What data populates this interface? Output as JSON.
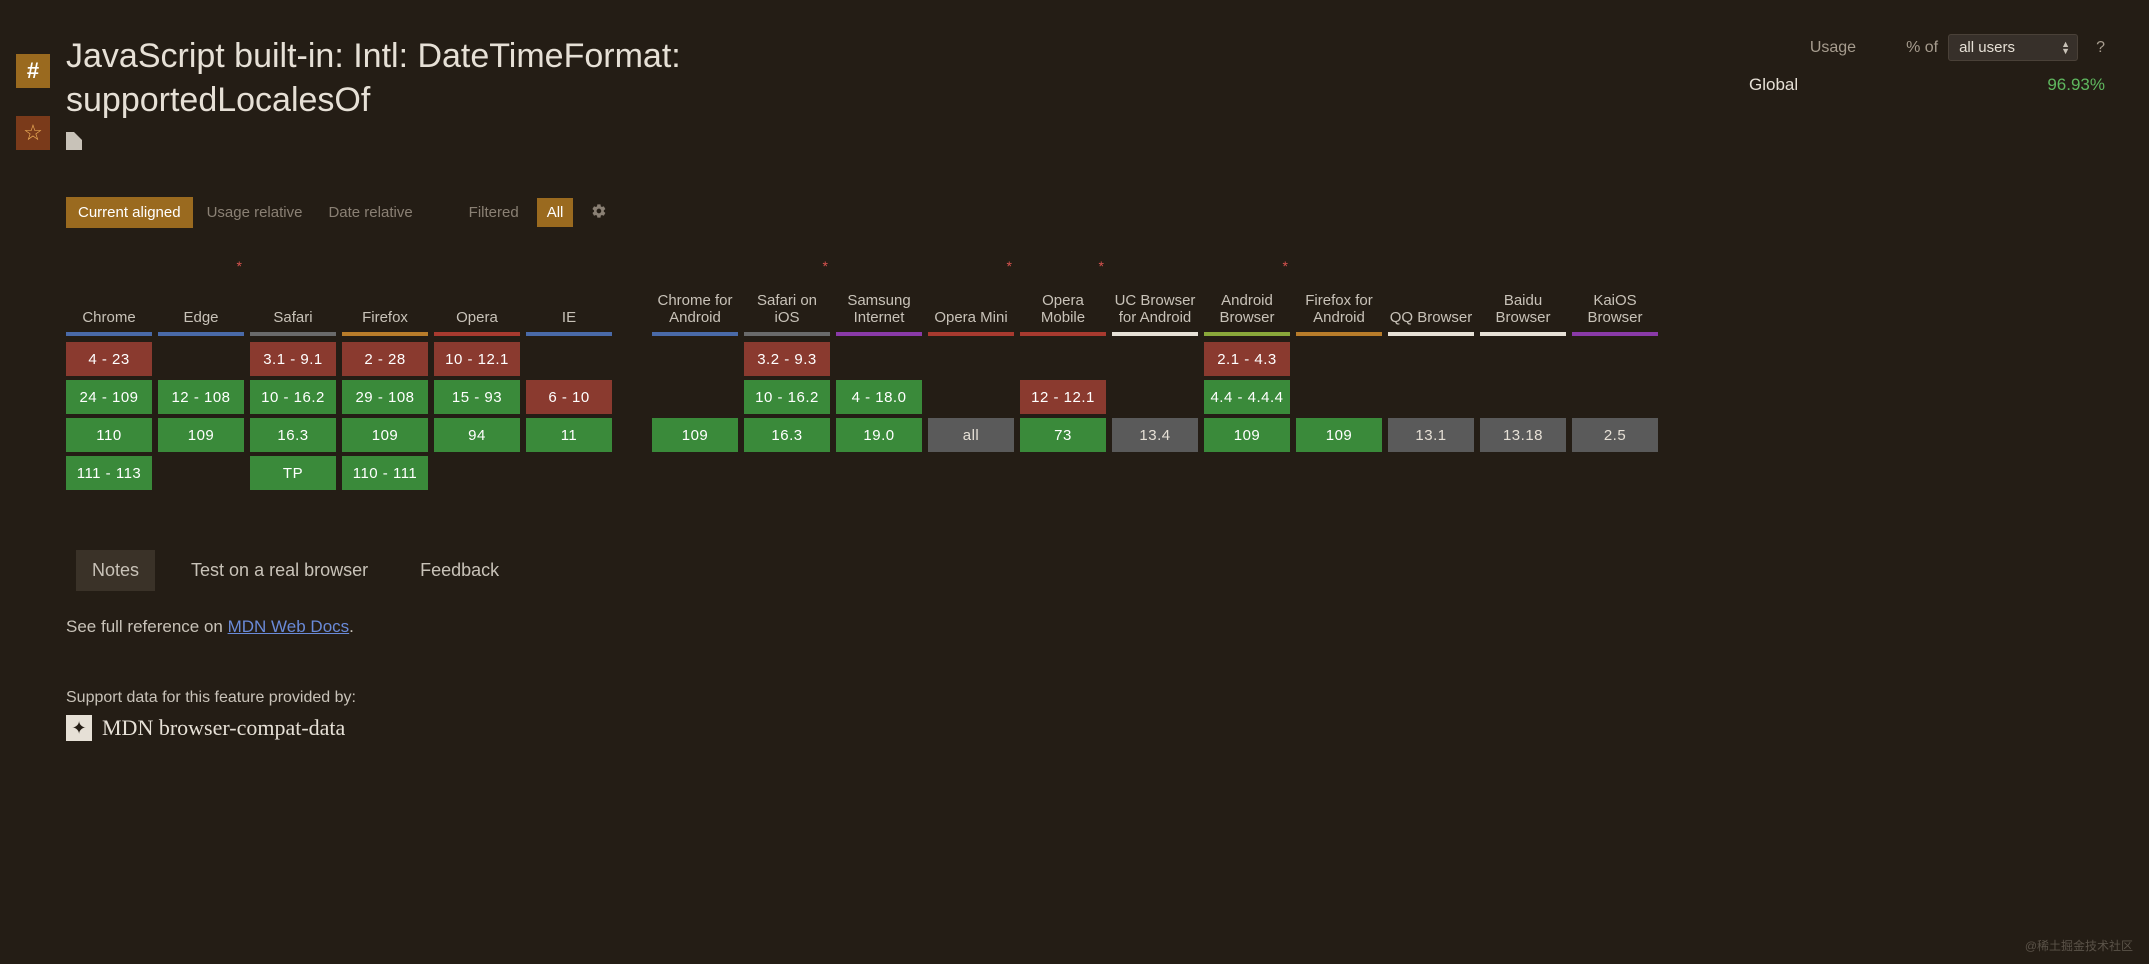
{
  "title": "JavaScript built-in: Intl: DateTimeFormat: supportedLocalesOf",
  "usage": {
    "label": "Usage",
    "pct_prefix": "% of",
    "select_value": "all users",
    "help": "?",
    "global_label": "Global",
    "global_pct": "96.93%"
  },
  "view_tabs": {
    "current": "Current aligned",
    "usage_rel": "Usage relative",
    "date_rel": "Date relative"
  },
  "filter": {
    "label": "Filtered",
    "all": "All"
  },
  "lower_tabs": {
    "notes": "Notes",
    "test": "Test on a real browser",
    "feedback": "Feedback"
  },
  "notes": {
    "see_ref_prefix": "See full reference on ",
    "see_ref_link": "MDN Web Docs",
    "see_ref_suffix": "."
  },
  "provided": {
    "line": "Support data for this feature provided by:",
    "source": "MDN browser-compat-data"
  },
  "watermark": "@稀土掘金技术社区",
  "groups": [
    {
      "browsers": [
        {
          "name": "Chrome",
          "underline": "#4a6aa8",
          "star": false,
          "rows": [
            {
              "t": "4 - 23",
              "c": "red"
            },
            {
              "t": "24 - 109",
              "c": "green"
            },
            {
              "t": "110",
              "c": "green"
            },
            {
              "t": "111 - 113",
              "c": "green"
            }
          ]
        },
        {
          "name": "Edge",
          "underline": "#4a6aa8",
          "star": true,
          "rows": [
            {
              "t": "",
              "c": "empty"
            },
            {
              "t": "12 - 108",
              "c": "green"
            },
            {
              "t": "109",
              "c": "green"
            },
            {
              "t": "",
              "c": "empty"
            }
          ]
        },
        {
          "name": "Safari",
          "underline": "#6a6a6a",
          "star": false,
          "rows": [
            {
              "t": "3.1 - 9.1",
              "c": "red"
            },
            {
              "t": "10 - 16.2",
              "c": "green"
            },
            {
              "t": "16.3",
              "c": "green"
            },
            {
              "t": "TP",
              "c": "green"
            }
          ]
        },
        {
          "name": "Firefox",
          "underline": "#b87c2a",
          "star": false,
          "rows": [
            {
              "t": "2 - 28",
              "c": "red"
            },
            {
              "t": "29 - 108",
              "c": "green"
            },
            {
              "t": "109",
              "c": "green"
            },
            {
              "t": "110 - 111",
              "c": "green"
            }
          ]
        },
        {
          "name": "Opera",
          "underline": "#a83a2f",
          "star": false,
          "rows": [
            {
              "t": "10 - 12.1",
              "c": "red"
            },
            {
              "t": "15 - 93",
              "c": "green"
            },
            {
              "t": "94",
              "c": "green"
            },
            {
              "t": "",
              "c": "empty"
            }
          ]
        },
        {
          "name": "IE",
          "underline": "#4a6aa8",
          "star": false,
          "rows": [
            {
              "t": "",
              "c": "empty"
            },
            {
              "t": "6 - 10",
              "c": "red"
            },
            {
              "t": "11",
              "c": "green"
            },
            {
              "t": "",
              "c": "empty"
            }
          ]
        }
      ]
    },
    {
      "browsers": [
        {
          "name": "Chrome for Android",
          "underline": "#4a6aa8",
          "star": false,
          "rows": [
            {
              "t": "",
              "c": "empty"
            },
            {
              "t": "",
              "c": "empty"
            },
            {
              "t": "109",
              "c": "green"
            }
          ]
        },
        {
          "name": "Safari on iOS",
          "underline": "#6a6a6a",
          "star": true,
          "rows": [
            {
              "t": "3.2 - 9.3",
              "c": "red"
            },
            {
              "t": "10 - 16.2",
              "c": "green"
            },
            {
              "t": "16.3",
              "c": "green"
            }
          ]
        },
        {
          "name": "Samsung Internet",
          "underline": "#8a3aa8",
          "star": false,
          "rows": [
            {
              "t": "",
              "c": "empty"
            },
            {
              "t": "4 - 18.0",
              "c": "green"
            },
            {
              "t": "19.0",
              "c": "green"
            }
          ]
        },
        {
          "name": "Opera Mini",
          "underline": "#a83a2f",
          "star": true,
          "rows": [
            {
              "t": "",
              "c": "empty"
            },
            {
              "t": "",
              "c": "empty"
            },
            {
              "t": "all",
              "c": "gray"
            }
          ]
        },
        {
          "name": "Opera Mobile",
          "underline": "#a83a2f",
          "star": true,
          "rows": [
            {
              "t": "",
              "c": "empty"
            },
            {
              "t": "12 - 12.1",
              "c": "red"
            },
            {
              "t": "73",
              "c": "green"
            }
          ]
        },
        {
          "name": "UC Browser for Android",
          "underline": "#e6e0d6",
          "star": false,
          "rows": [
            {
              "t": "",
              "c": "empty"
            },
            {
              "t": "",
              "c": "empty"
            },
            {
              "t": "13.4",
              "c": "gray"
            }
          ]
        },
        {
          "name": "Android Browser",
          "underline": "#8aa83a",
          "star": true,
          "rows": [
            {
              "t": "2.1 - 4.3",
              "c": "red"
            },
            {
              "t": "4.4 - 4.4.4",
              "c": "green"
            },
            {
              "t": "109",
              "c": "green"
            }
          ]
        },
        {
          "name": "Firefox for Android",
          "underline": "#b87c2a",
          "star": false,
          "rows": [
            {
              "t": "",
              "c": "empty"
            },
            {
              "t": "",
              "c": "empty"
            },
            {
              "t": "109",
              "c": "green"
            }
          ]
        },
        {
          "name": "QQ Browser",
          "underline": "#e6e0d6",
          "star": false,
          "rows": [
            {
              "t": "",
              "c": "empty"
            },
            {
              "t": "",
              "c": "empty"
            },
            {
              "t": "13.1",
              "c": "gray"
            }
          ]
        },
        {
          "name": "Baidu Browser",
          "underline": "#e6e0d6",
          "star": false,
          "rows": [
            {
              "t": "",
              "c": "empty"
            },
            {
              "t": "",
              "c": "empty"
            },
            {
              "t": "13.18",
              "c": "gray"
            }
          ]
        },
        {
          "name": "KaiOS Browser",
          "underline": "#8a3aa8",
          "star": false,
          "rows": [
            {
              "t": "",
              "c": "empty"
            },
            {
              "t": "",
              "c": "empty"
            },
            {
              "t": "2.5",
              "c": "gray"
            }
          ]
        }
      ]
    }
  ]
}
